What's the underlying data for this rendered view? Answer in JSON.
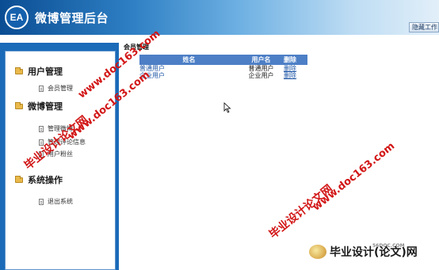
{
  "header": {
    "logo_text": "EA",
    "title": "微博管理后台",
    "hide_button": "隐藏工作"
  },
  "sidebar": {
    "groups": [
      {
        "label": "用户管理",
        "items": [
          {
            "label": "会员管理"
          }
        ]
      },
      {
        "label": "微博管理",
        "items": [
          {
            "label": "管理微博"
          },
          {
            "label": "管理评论信息"
          },
          {
            "label": "用户粉丝"
          }
        ]
      },
      {
        "label": "系统操作",
        "items": [
          {
            "label": "退出系统"
          }
        ]
      }
    ]
  },
  "main": {
    "title": "会员管理",
    "table": {
      "headers": [
        "姓名",
        "用户名",
        "删除"
      ],
      "rows": [
        [
          "普通用户",
          "普通用户",
          "删除"
        ],
        [
          "企业用户",
          "企业用户",
          "删除"
        ]
      ]
    }
  },
  "watermark": {
    "cn": "毕业设计论文网",
    "url": "www.doc163.com",
    "footer_site": "56DOC.COM",
    "footer_text": "毕业设计(论文)网"
  },
  "colors": {
    "header_dark": "#0b4d93",
    "sidebar_bg": "#1a6ab8",
    "table_header": "#4d7fc6",
    "link": "#1d55a5",
    "watermark": "#d21616"
  }
}
